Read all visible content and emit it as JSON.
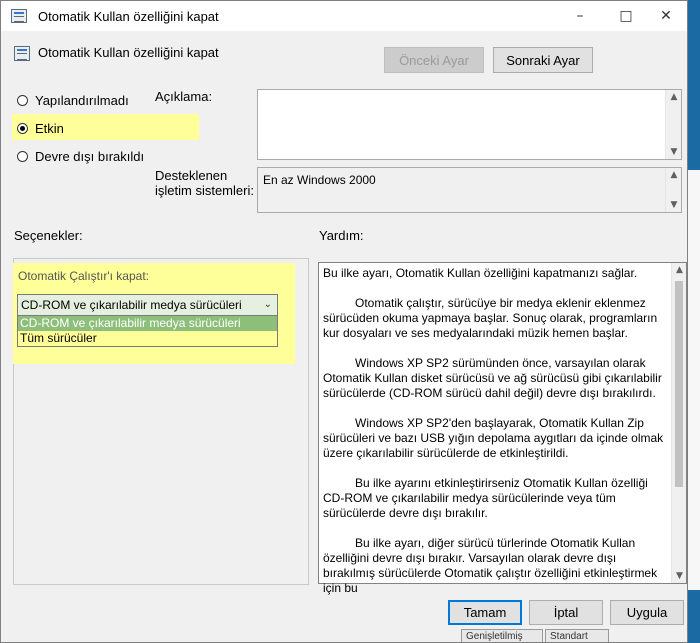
{
  "window": {
    "title": "Otomatik Kullan özelliğini kapat",
    "minimize_icon": "minimize-icon",
    "maximize_icon": "maximize-icon",
    "close_icon": "close-icon"
  },
  "header": {
    "title": "Otomatik Kullan özelliğini kapat",
    "prev_label": "Önceki Ayar",
    "next_label": "Sonraki Ayar"
  },
  "state": {
    "options": [
      {
        "label": "Yapılandırılmadı",
        "checked": false
      },
      {
        "label": "Etkin",
        "checked": true
      },
      {
        "label": "Devre dışı bırakıldı",
        "checked": false
      }
    ]
  },
  "description": {
    "label": "Açıklama:",
    "value": ""
  },
  "supported": {
    "label_line1": "Desteklenen",
    "label_line2": "işletim sistemleri:",
    "value": "En az Windows 2000"
  },
  "sections": {
    "options_label": "Seçenekler:",
    "help_label": "Yardım:"
  },
  "options_panel": {
    "autorun_label": "Otomatik Çalıştır'ı kapat:",
    "selected_value": "CD-ROM ve çıkarılabilir medya sürücüleri",
    "dropdown_options": [
      "CD-ROM ve çıkarılabilir medya sürücüleri",
      "Tüm sürücüler"
    ]
  },
  "help": {
    "paragraphs": [
      "Bu ilke ayarı, Otomatik Kullan özelliğini kapatmanızı sağlar.",
      "Otomatik çalıştır, sürücüye bir medya eklenir eklenmez sürücüden okuma yapmaya başlar. Sonuç olarak, programların kur dosyaları ve ses medyalarındaki müzik hemen başlar.",
      "Windows XP SP2 sürümünden önce, varsayılan olarak Otomatik Kullan disket sürücüsü ve ağ sürücüsü gibi çıkarılabilir sürücülerde (CD-ROM sürücü dahil değil) devre dışı bırakılırdı.",
      "Windows XP SP2'den başlayarak, Otomatik Kullan Zip sürücüleri ve bazı USB yığın depolama aygıtları da içinde olmak üzere çıkarılabilir sürücülerde de etkinleştirildi.",
      "Bu ilke ayarını etkinleştirirseniz Otomatik Kullan özelliği CD-ROM ve çıkarılabilir medya sürücülerinde veya tüm sürücülerde devre dışı bırakılır.",
      "Bu ilke ayarı, diğer sürücü türlerinde Otomatik Kullan özelliğini devre dışı bırakır. Varsayılan olarak devre dışı bırakılmış sürücülerde Otomatik çalıştır özelliğini etkinleştirmek için bu"
    ]
  },
  "footer": {
    "ok_label": "Tamam",
    "cancel_label": "İptal",
    "apply_label": "Uygula"
  },
  "background": {
    "tab1": "Genişletilmiş",
    "tab2": "Standart"
  },
  "colors": {
    "highlight": "#ffff99",
    "accent": "#0078d7",
    "selected_option": "#8dbf7a"
  }
}
